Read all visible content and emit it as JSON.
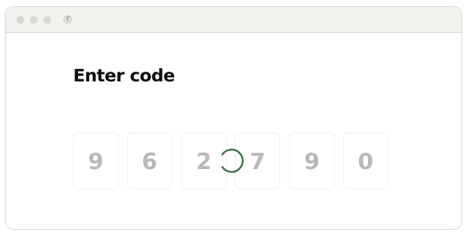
{
  "window": {
    "favicon_glyph": "f"
  },
  "page": {
    "title": "Enter code"
  },
  "code": {
    "digits": [
      "9",
      "6",
      "2",
      "7",
      "9",
      "0"
    ],
    "state": "loading"
  },
  "colors": {
    "spinner": "#3f6b4c",
    "digit_text": "#b8b8b8",
    "titlebar": "#f3f3ed"
  },
  "icons": {
    "spinner": "loading-spinner-icon"
  }
}
